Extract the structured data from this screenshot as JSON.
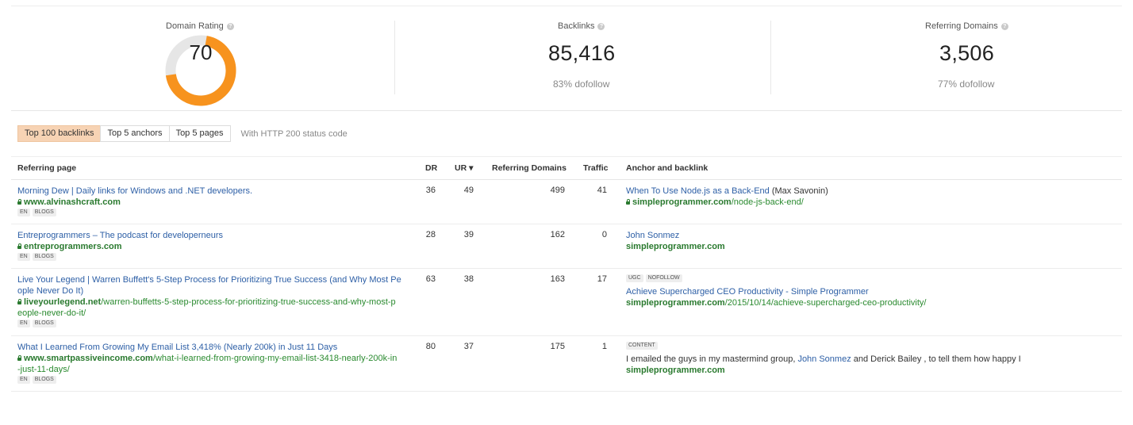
{
  "stats": {
    "domain_rating": {
      "label": "Domain Rating",
      "value": "70",
      "fraction": 0.7
    },
    "backlinks": {
      "label": "Backlinks",
      "value": "85,416",
      "sub": "83% dofollow"
    },
    "referring_domains": {
      "label": "Referring Domains",
      "value": "3,506",
      "sub": "77% dofollow"
    },
    "help_glyph": "?"
  },
  "tabs": [
    {
      "label": "Top 100 backlinks",
      "active": true
    },
    {
      "label": "Top 5 anchors",
      "active": false
    },
    {
      "label": "Top 5 pages",
      "active": false
    }
  ],
  "tab_note": "With HTTP 200 status code",
  "columns": {
    "referring_page": "Referring page",
    "dr": "DR",
    "ur": "UR",
    "ur_sort": "▾",
    "referring_domains": "Referring Domains",
    "traffic": "Traffic",
    "anchor": "Anchor and backlink"
  },
  "rows": [
    {
      "title": "Morning Dew | Daily links for Windows and .NET developers.",
      "domain": "www.alvinashcraft.com",
      "path": "",
      "badges": [
        "EN",
        "BLOGS"
      ],
      "dr": "36",
      "ur": "49",
      "ref_domains": "499",
      "traffic": "41",
      "anchor_badges": [],
      "anchor_text": "When To Use Node.js as a Back-End",
      "anchor_extra": " (Max Savonin)",
      "target_domain": "simpleprogrammer.com",
      "target_path": "/node-js-back-end/"
    },
    {
      "title": "Entreprogrammers – The podcast for developerneurs",
      "domain": "entreprogrammers.com",
      "path": "",
      "badges": [
        "EN",
        "BLOGS"
      ],
      "dr": "28",
      "ur": "39",
      "ref_domains": "162",
      "traffic": "0",
      "anchor_badges": [],
      "anchor_text": "John Sonmez",
      "anchor_extra": "",
      "target_domain": "simpleprogrammer.com",
      "target_path": ""
    },
    {
      "title_line1": "Live Your Legend | Warren Buffett's 5-Step Process for Prioritizing True Success (and Why Most Pe",
      "title_line2": "ople Never Do It)",
      "domain": "liveyourlegend.net",
      "path_line1": "/warren-buffetts-5-step-process-for-prioritizing-true-success-and-why-most-p",
      "path_line2": "eople-never-do-it/",
      "badges": [
        "EN",
        "BLOGS"
      ],
      "dr": "63",
      "ur": "38",
      "ref_domains": "163",
      "traffic": "17",
      "anchor_badges": [
        "UGC",
        "NOFOLLOW"
      ],
      "anchor_text": "Achieve Supercharged CEO Productivity - Simple Programmer",
      "target_domain": "simpleprogrammer.com",
      "target_path": "/2015/10/14/achieve-supercharged-ceo-productivity/"
    },
    {
      "title": "What I Learned From Growing My Email List 3,418% (Nearly 200k) in Just 11 Days",
      "domain": "www.smartpassiveincome.com",
      "path_line1": "/what-i-learned-from-growing-my-email-list-3418-nearly-200k-in",
      "path_line2": "-just-11-days/",
      "badges": [
        "EN",
        "BLOGS"
      ],
      "dr": "80",
      "ur": "37",
      "ref_domains": "175",
      "traffic": "1",
      "anchor_badges": [
        "CONTENT"
      ],
      "context_before": "I emailed the guys in my mastermind group, ",
      "anchor_text": "John Sonmez",
      "context_after": " and Derick Bailey , to tell them how happy I",
      "target_domain": "simpleprogrammer.com",
      "target_path": ""
    }
  ],
  "colors": {
    "gauge_orange": "#f7931e",
    "gauge_track": "#e6e6e6",
    "link_blue": "#2d5fa6",
    "url_green": "#2a8a2f",
    "active_tab": "#f7d3b4"
  }
}
